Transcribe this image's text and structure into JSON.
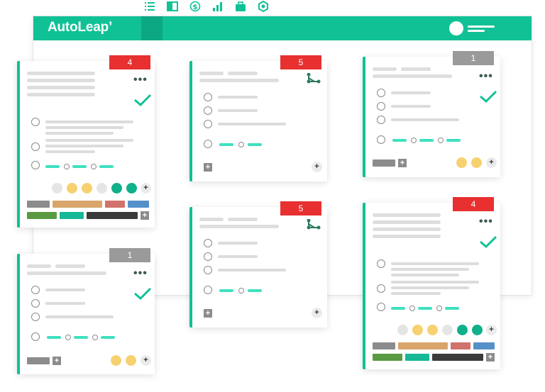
{
  "app": {
    "logo": "AutoLeap’",
    "top_icons": [
      "list-icon",
      "board-icon",
      "dollar-icon",
      "bar-chart-icon",
      "briefcase-icon",
      "gear-icon"
    ]
  },
  "cards": [
    {
      "id": "card-1",
      "badge": "4",
      "badge_color": "#e83030"
    },
    {
      "id": "card-2",
      "badge": "5",
      "badge_color": "#e83030"
    },
    {
      "id": "card-3",
      "badge": "1",
      "badge_color": "#9a9a9a"
    },
    {
      "id": "card-4",
      "badge": "1",
      "badge_color": "#9a9a9a"
    },
    {
      "id": "card-5",
      "badge": "5",
      "badge_color": "#e83030"
    },
    {
      "id": "card-6",
      "badge": "4",
      "badge_color": "#e83030"
    }
  ],
  "colors": {
    "accent": "#10c195",
    "badge_red": "#e83030",
    "badge_gray": "#9a9a9a",
    "yellow": "#f7d170",
    "teal_dot": "#10b08a",
    "light_dot": "#e5e5e5",
    "tag_gray": "#8c8c8c",
    "tag_tan": "#d9a56a",
    "tag_rose": "#d1726c",
    "tag_blue": "#5591c9",
    "tag_green": "#5a9a42",
    "tag_teal": "#16b896",
    "tag_dark": "#3b3b3b"
  },
  "plus_label": "+"
}
